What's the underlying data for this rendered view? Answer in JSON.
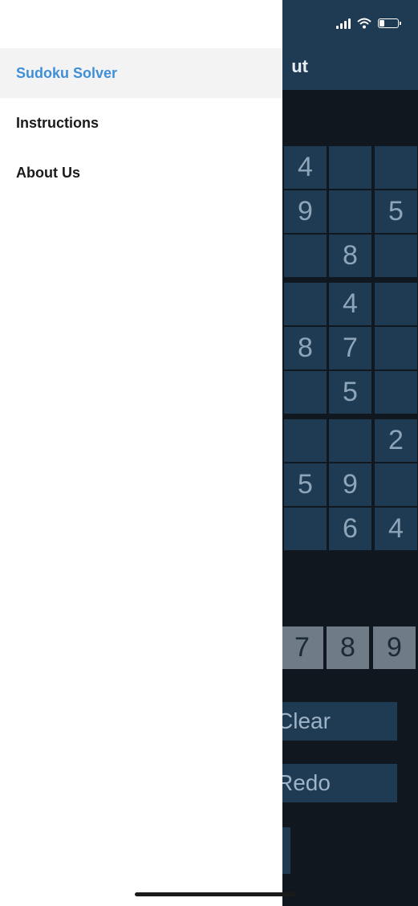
{
  "app": {
    "title": "Sudoku Solver",
    "title_visible_fragment": "ut",
    "colors": {
      "header": "#1f3a53",
      "background": "#10171e",
      "cell": "#1f3a53",
      "cell_text": "#8ea4b8",
      "digit_button": "#6f7b86",
      "drawer": "#ffffff",
      "active_item_text": "#3f8fd8",
      "active_item_bg": "#f3f3f3"
    }
  },
  "status_bar": {
    "icons": [
      "cellular-signal-icon",
      "wifi-icon",
      "battery-icon"
    ]
  },
  "drawer": {
    "items": [
      {
        "label": "Sudoku Solver",
        "active": true
      },
      {
        "label": "Instructions",
        "active": false
      },
      {
        "label": "About Us",
        "active": false
      }
    ]
  },
  "board": {
    "visible_cells": [
      {
        "row": 0,
        "col": 0,
        "value": "4"
      },
      {
        "row": 0,
        "col": 1,
        "value": ""
      },
      {
        "row": 0,
        "col": 2,
        "value": ""
      },
      {
        "row": 1,
        "col": 0,
        "value": "9"
      },
      {
        "row": 1,
        "col": 1,
        "value": ""
      },
      {
        "row": 1,
        "col": 2,
        "value": "5"
      },
      {
        "row": 2,
        "col": 0,
        "value": ""
      },
      {
        "row": 2,
        "col": 1,
        "value": "8"
      },
      {
        "row": 2,
        "col": 2,
        "value": ""
      },
      {
        "row": 3,
        "col": 0,
        "value": ""
      },
      {
        "row": 3,
        "col": 1,
        "value": "4"
      },
      {
        "row": 3,
        "col": 2,
        "value": ""
      },
      {
        "row": 4,
        "col": 0,
        "value": "8"
      },
      {
        "row": 4,
        "col": 1,
        "value": "7"
      },
      {
        "row": 4,
        "col": 2,
        "value": ""
      },
      {
        "row": 5,
        "col": 0,
        "value": ""
      },
      {
        "row": 5,
        "col": 1,
        "value": "5"
      },
      {
        "row": 5,
        "col": 2,
        "value": ""
      },
      {
        "row": 6,
        "col": 0,
        "value": ""
      },
      {
        "row": 6,
        "col": 1,
        "value": ""
      },
      {
        "row": 6,
        "col": 2,
        "value": "2"
      },
      {
        "row": 7,
        "col": 0,
        "value": "5"
      },
      {
        "row": 7,
        "col": 1,
        "value": "9"
      },
      {
        "row": 7,
        "col": 2,
        "value": ""
      },
      {
        "row": 8,
        "col": 0,
        "value": ""
      },
      {
        "row": 8,
        "col": 1,
        "value": "6"
      },
      {
        "row": 8,
        "col": 2,
        "value": "4"
      }
    ]
  },
  "digit_pad": {
    "visible_digits": [
      "7",
      "8",
      "9"
    ]
  },
  "actions": {
    "clear_label": "Clear",
    "redo_label": "Redo"
  }
}
